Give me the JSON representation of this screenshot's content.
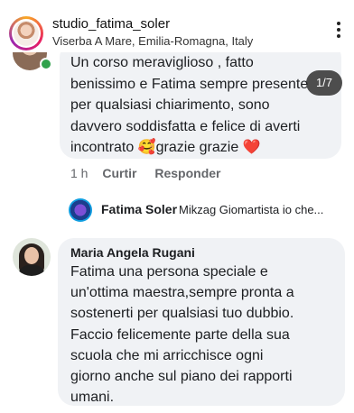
{
  "header": {
    "username": "studio_fatima_soler",
    "location": "Viserba A Mare, Emilia-Romagna, Italy"
  },
  "comment1": {
    "lines": [
      "Un corso meraviglioso , fatto",
      "benissimo e Fatima sempre presente",
      "per qualsiasi chiarimento, sono",
      "davvero soddisfatta e felice di averti",
      "incontrato 🥰grazie grazie ❤️"
    ],
    "time": "1 h",
    "like_label": "Curtir",
    "reply_label": "Responder",
    "media_counter": "1/7"
  },
  "reply_preview": {
    "name": "Fatima Soler",
    "text": "Mikzag Giomartista io che..."
  },
  "comment2": {
    "name": "Maria Angela Rugani",
    "lines": [
      "Fatima una persona speciale e",
      "un'ottima maestra,sempre pronta a",
      "sostenerti per qualsiasi tuo dubbio.",
      "Faccio felicemente parte della sua",
      "scuola che mi arricchisce ogni",
      "giorno anche sul piano dei rapporti",
      "umani."
    ]
  },
  "icons": {
    "more": "more-vertical-icon",
    "online": "online-dot-icon"
  },
  "colors": {
    "bubble": "#f0f2f5",
    "online": "#31a24c",
    "meta_text": "#65676b"
  }
}
